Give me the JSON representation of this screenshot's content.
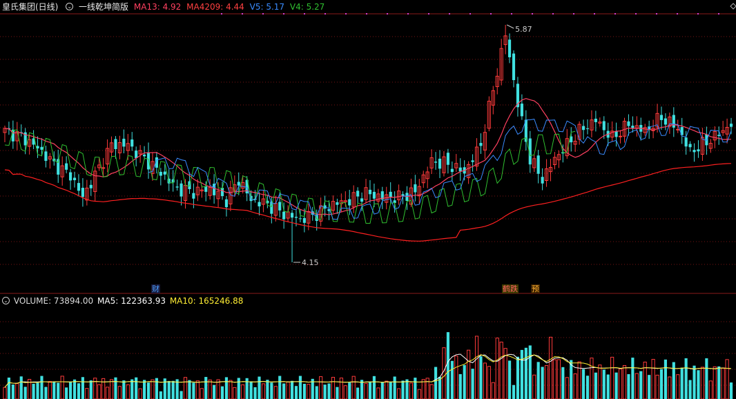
{
  "header": {
    "title": "皇氏集团(日线)",
    "indicator": "一线乾坤简版",
    "items": [
      {
        "label": "MA13: 4.92",
        "color": "#ff4060"
      },
      {
        "label": "MA4209: 4.44",
        "color": "#ff4040"
      },
      {
        "label": "V5: 5.17",
        "color": "#3a8cff"
      },
      {
        "label": "V4: 5.27",
        "color": "#30c030"
      }
    ]
  },
  "volume_header": {
    "label": "VOLUME: 73894.00",
    "ma5": "MA5: 122363.93",
    "ma10": "MA10: 165246.88",
    "colors": {
      "label": "#dcdcdc",
      "ma5": "#ffffff",
      "ma10": "#ffee33"
    }
  },
  "annotations": {
    "high_label": "5.87",
    "low_label": "4.15"
  },
  "badges": [
    {
      "text": "财",
      "color": "#4aa0ff",
      "bg": "#1a1a3a"
    },
    {
      "text": "鹤跌",
      "color": "#ff6060",
      "bg": "#3a3a00"
    },
    {
      "text": "预",
      "color": "#ffb030",
      "bg": "#3a2000"
    }
  ],
  "colors": {
    "up": "#ff3b3b",
    "down": "#40e0e0",
    "ma13": "#ff4060",
    "ma4209": "#ff2020",
    "v5": "#3a8cff",
    "v4": "#30c030",
    "grid": "#7a1515",
    "bg": "#000000"
  },
  "chart_data": {
    "type": "candlestick",
    "ylim": [
      4.0,
      5.9
    ],
    "high": 5.87,
    "low": 4.15,
    "series_visible": [
      "MA13",
      "MA4209",
      "V5",
      "V4"
    ],
    "volume_ylim": [
      0,
      350000
    ]
  }
}
